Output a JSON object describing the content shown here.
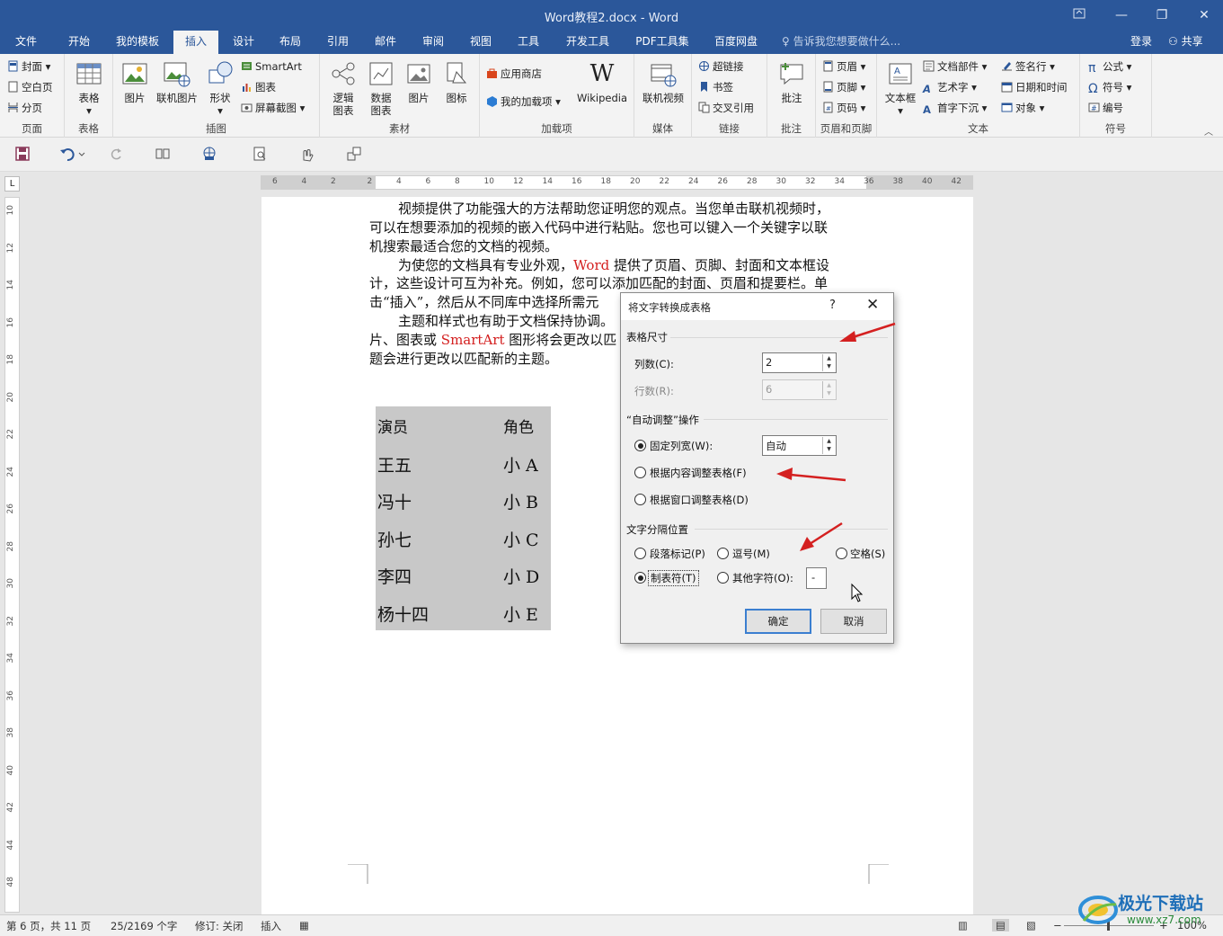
{
  "window": {
    "title": "Word教程2.docx - Word"
  },
  "tabs": [
    "文件",
    "开始",
    "我的模板",
    "插入",
    "设计",
    "布局",
    "引用",
    "邮件",
    "审阅",
    "视图",
    "工具",
    "开发工具",
    "PDF工具集",
    "百度网盘"
  ],
  "tell_me": "告诉我您想要做什么...",
  "signin": "登录",
  "share": "共享",
  "ribbon": {
    "pages": {
      "items": [
        "封面",
        "空白页",
        "分页"
      ],
      "label": "页面"
    },
    "tables": {
      "button": "表格",
      "label": "表格"
    },
    "illustrations": {
      "picture": "图片",
      "online_picture": "联机图片",
      "shapes": "形状",
      "smartart": "SmartArt",
      "chart": "图表",
      "screenshot": "屏幕截图",
      "label": "插图"
    },
    "material": {
      "logic": [
        "逻辑",
        "图表"
      ],
      "data": [
        "数据",
        "图表"
      ],
      "picture": "图片",
      "icon": "图标",
      "label": "素材"
    },
    "addins": {
      "store": "应用商店",
      "my_addins": "我的加载项",
      "wikipedia": "Wikipedia",
      "label": "加载项"
    },
    "media": {
      "online_video": "联机视频",
      "label": "媒体"
    },
    "links": {
      "items": [
        "超链接",
        "书签",
        "交叉引用"
      ],
      "label": "链接"
    },
    "comments": {
      "button": "批注",
      "label": "批注"
    },
    "header_footer": {
      "items": [
        "页眉",
        "页脚",
        "页码"
      ],
      "label": "页眉和页脚"
    },
    "text": {
      "textbox": "文本框",
      "col1": [
        "文档部件",
        "艺术字",
        "首字下沉"
      ],
      "col2": [
        "签名行",
        "日期和时间",
        "对象"
      ],
      "label": "文本"
    },
    "symbols": {
      "items": [
        "公式",
        "符号",
        "编号"
      ],
      "label": "符号"
    }
  },
  "ruler": {
    "h_labels": [
      "6",
      "4",
      "2",
      "2",
      "4",
      "6",
      "8",
      "10",
      "12",
      "14",
      "16",
      "18",
      "20",
      "22",
      "24",
      "26",
      "28",
      "30",
      "32",
      "34",
      "36",
      "38",
      "40",
      "42"
    ],
    "v_labels": [
      "10",
      "12",
      "14",
      "16",
      "18",
      "20",
      "22",
      "24",
      "26",
      "28",
      "30",
      "32",
      "34",
      "36",
      "38",
      "40",
      "42",
      "44",
      "48"
    ]
  },
  "document": {
    "p1": [
      "视频提供了功能强大的方法帮助您证明您的观点。当您单击联机视频时，",
      "可以在想要添加的视频的嵌入代码中进行粘贴。您也可以键入一个关键字以联",
      "机搜索最适合您的文档的视频。"
    ],
    "p2_lines": [
      {
        "pre": "为使您的文档具有专业外观，",
        "red": "Word",
        "post": "提供了页眉、页脚、封面和文本框设"
      },
      {
        "pre": "计，这些设计可互为补充。例如，您可以添加匹配的封面、页眉和提要栏。单",
        "red": "",
        "post": ""
      },
      {
        "pre": "击“插入”，然后从不同库中选择所需元",
        "red": "",
        "post": ""
      }
    ],
    "p3_lines": [
      {
        "pre": "主题和样式也有助于文档保持协调。",
        "red": "",
        "post": ""
      },
      {
        "pre": "片、图表或",
        "red": "SmartArt",
        "post": "图形将会更改以匹"
      },
      {
        "pre": "题会进行更改以匹配新的主题。",
        "red": "",
        "post": ""
      }
    ],
    "table": [
      [
        "演员",
        "角色"
      ],
      [
        "王五",
        "小 A"
      ],
      [
        "冯十",
        "小 B"
      ],
      [
        "孙七",
        "小 C"
      ],
      [
        "李四",
        "小 D"
      ],
      [
        "杨十四",
        "小 E"
      ]
    ]
  },
  "dialog": {
    "title": "将文字转换成表格",
    "help": "?",
    "close": "✕",
    "size_section": "表格尺寸",
    "cols_label": "列数(C):",
    "cols_value": "2",
    "rows_label": "行数(R):",
    "rows_value": "6",
    "autofit_section": "“自动调整”操作",
    "fixed_width": "固定列宽(W):",
    "fixed_width_value": "自动",
    "fit_content": "根据内容调整表格(F)",
    "fit_window": "根据窗口调整表格(D)",
    "separator_section": "文字分隔位置",
    "sep_paragraph": "段落标记(P)",
    "sep_comma": "逗号(M)",
    "sep_space": "空格(S)",
    "sep_tab": "制表符(T)",
    "sep_other": "其他字符(O):",
    "other_value": "-",
    "ok": "确定",
    "cancel": "取消"
  },
  "status": {
    "page": "第 6 页，共 11 页",
    "words": "25/2169 个字",
    "track": "修订: 关闭",
    "insert": "插入",
    "zoom": "100%"
  },
  "watermark": {
    "name": "极光下载站",
    "url": "www.xz7.com"
  },
  "colors": {
    "title_bar": "#2b579a",
    "accent_red": "#d42020"
  }
}
